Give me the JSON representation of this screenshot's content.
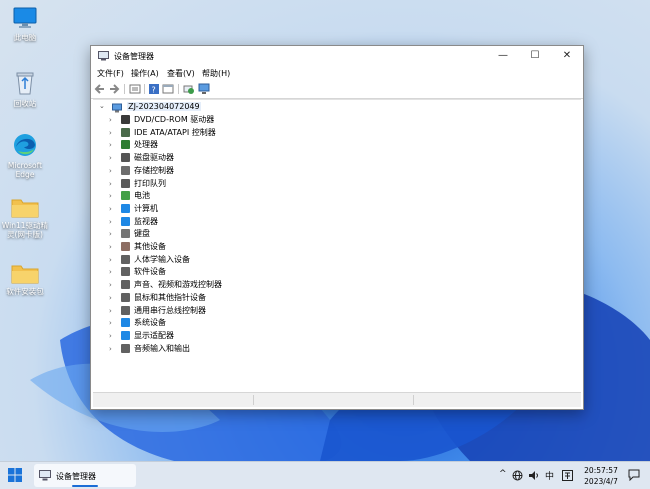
{
  "desktop": {
    "icons": [
      {
        "label": "此电脑",
        "icon": "computer-icon"
      },
      {
        "label": "回收站",
        "icon": "recycle-bin-icon"
      },
      {
        "label": "Microsoft Edge",
        "icon": "edge-icon"
      },
      {
        "label": "Win11驱动精灵(网卡版)",
        "icon": "folder-icon"
      },
      {
        "label": "软件安装包",
        "icon": "folder-icon"
      }
    ]
  },
  "window": {
    "title": "设备管理器",
    "controls": {
      "minimize": "—",
      "maximize": "☐",
      "close": "✕"
    },
    "menu": [
      "文件(F)",
      "操作(A)",
      "查看(V)",
      "帮助(H)"
    ],
    "toolbar": [
      "back-icon",
      "forward-icon",
      "properties-icon",
      "help-icon",
      "view-icon",
      "scan-hardware-icon",
      "monitor-icon"
    ],
    "tree": {
      "root": "ZJ-202304072049",
      "items": [
        {
          "label": "DVD/CD-ROM 驱动器",
          "icon": "dvd-drive-icon",
          "color": "#3a3a3a"
        },
        {
          "label": "IDE ATA/ATAPI 控制器",
          "icon": "ide-controller-icon",
          "color": "#4a6a4a"
        },
        {
          "label": "处理器",
          "icon": "processor-icon",
          "color": "#2e7d32"
        },
        {
          "label": "磁盘驱动器",
          "icon": "disk-drive-icon",
          "color": "#555555"
        },
        {
          "label": "存储控制器",
          "icon": "storage-controller-icon",
          "color": "#6d6d6d"
        },
        {
          "label": "打印队列",
          "icon": "printer-icon",
          "color": "#5a5a5a"
        },
        {
          "label": "电池",
          "icon": "battery-icon",
          "color": "#43a047"
        },
        {
          "label": "计算机",
          "icon": "computer-icon",
          "color": "#1e88e5"
        },
        {
          "label": "监视器",
          "icon": "monitor-icon",
          "color": "#1e88e5"
        },
        {
          "label": "键盘",
          "icon": "keyboard-icon",
          "color": "#757575"
        },
        {
          "label": "其他设备",
          "icon": "other-devices-icon",
          "color": "#8d6e63"
        },
        {
          "label": "人体学输入设备",
          "icon": "hid-icon",
          "color": "#616161"
        },
        {
          "label": "软件设备",
          "icon": "software-device-icon",
          "color": "#616161"
        },
        {
          "label": "声音、视频和游戏控制器",
          "icon": "speaker-icon",
          "color": "#616161"
        },
        {
          "label": "鼠标和其他指针设备",
          "icon": "mouse-icon",
          "color": "#616161"
        },
        {
          "label": "通用串行总线控制器",
          "icon": "usb-icon",
          "color": "#616161"
        },
        {
          "label": "系统设备",
          "icon": "system-device-icon",
          "color": "#1e88e5"
        },
        {
          "label": "显示适配器",
          "icon": "display-adapter-icon",
          "color": "#1e88e5"
        },
        {
          "label": "音频输入和输出",
          "icon": "audio-icon",
          "color": "#616161"
        }
      ]
    }
  },
  "taskbar": {
    "app_label": "设备管理器",
    "tray": {
      "chevron": "^",
      "ime": "中"
    },
    "time": "20:57:57",
    "date": "2023/4/7"
  }
}
